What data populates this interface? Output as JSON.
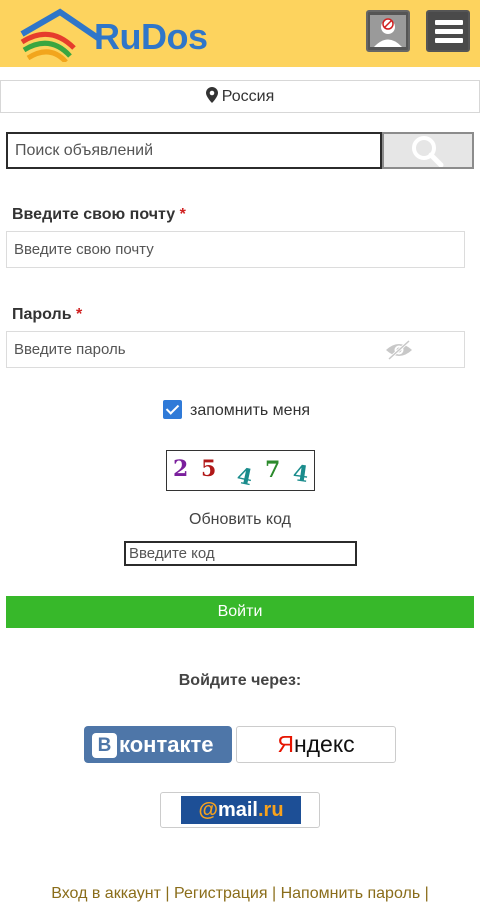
{
  "brand": {
    "name": "RuDos"
  },
  "region": {
    "label": "Россия",
    "icon": "location-pin-icon"
  },
  "search": {
    "placeholder": "Поиск объявлений"
  },
  "login": {
    "email_label": "Введите свою почту",
    "email_placeholder": "Введите свою почту",
    "password_label": "Пароль",
    "password_placeholder": "Введите пароль",
    "required_mark": "*",
    "remember_label": "запомнить меня",
    "remember_checked": true
  },
  "captcha": {
    "digits": [
      "2",
      "5",
      "4",
      "7",
      "4"
    ],
    "refresh_label": "Обновить код",
    "input_placeholder": "Введите код"
  },
  "submit_label": "Войти",
  "social": {
    "title": "Войдите через:",
    "vk_label": "контакте",
    "vk_badge": "В",
    "yandex_first": "Я",
    "yandex_rest": "ндекс",
    "mail_at": "@",
    "mail_name": "mail",
    "mail_ru": ".ru"
  },
  "footer": {
    "links": [
      "Вход в аккаунт",
      "Регистрация",
      "Напомнить пароль"
    ],
    "separator": "|"
  },
  "colors": {
    "header": "#fdd35e",
    "accent": "#2f76c9",
    "submit": "#37b82a",
    "vk": "#4e76a8",
    "mail": "#1d4f96"
  }
}
